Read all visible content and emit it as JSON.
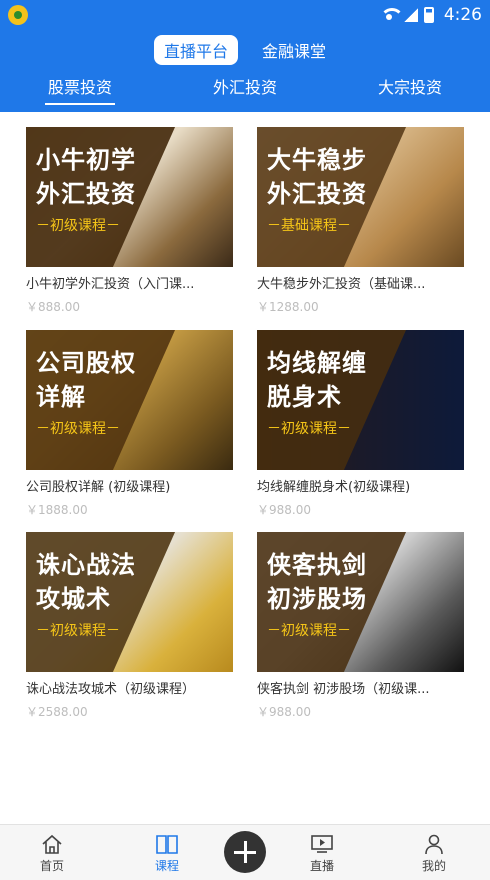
{
  "status_bar": {
    "time": "4:26"
  },
  "segment": [
    {
      "label": "直播平台",
      "active": true
    },
    {
      "label": "金融课堂",
      "active": false
    }
  ],
  "category_tabs": [
    {
      "label": "股票投资",
      "active": true
    },
    {
      "label": "外汇投资",
      "active": false
    },
    {
      "label": "大宗投资",
      "active": false
    }
  ],
  "courses": [
    {
      "thumb_title": "小牛初学\n外汇投资",
      "thumb_level": "－初级课程－",
      "title": "小牛初学外汇投资（入门课...",
      "price": "￥888.00"
    },
    {
      "thumb_title": "大牛稳步\n外汇投资",
      "thumb_level": "－基础课程－",
      "title": "大牛稳步外汇投资（基础课...",
      "price": "￥1288.00"
    },
    {
      "thumb_title": "公司股权\n详解",
      "thumb_level": "－初级课程－",
      "title": "公司股权详解 (初级课程)",
      "price": "￥1888.00"
    },
    {
      "thumb_title": "均线解缠\n脱身术",
      "thumb_level": "－初级课程－",
      "title": "均线解缠脱身术(初级课程)",
      "price": "￥988.00"
    },
    {
      "thumb_title": "诛心战法\n攻城术",
      "thumb_level": "－初级课程－",
      "title": "诛心战法攻城术（初级课程）",
      "price": "￥2588.00"
    },
    {
      "thumb_title": "侠客执剑\n初涉股场",
      "thumb_level": "－初级课程－",
      "title": "侠客执剑 初涉股场（初级课...",
      "price": "￥988.00"
    }
  ],
  "bottom_nav": [
    {
      "label": "首页",
      "icon": "home-icon",
      "active": false
    },
    {
      "label": "课程",
      "icon": "book-icon",
      "active": true
    },
    {
      "label": "",
      "icon": "plus-icon",
      "active": false
    },
    {
      "label": "直播",
      "icon": "live-tv-icon",
      "active": false
    },
    {
      "label": "我的",
      "icon": "person-icon",
      "active": false
    }
  ],
  "colors": {
    "header_blue": "#1f78e8",
    "level_gold": "#f5c518",
    "price_grey": "#bdbdbd"
  }
}
